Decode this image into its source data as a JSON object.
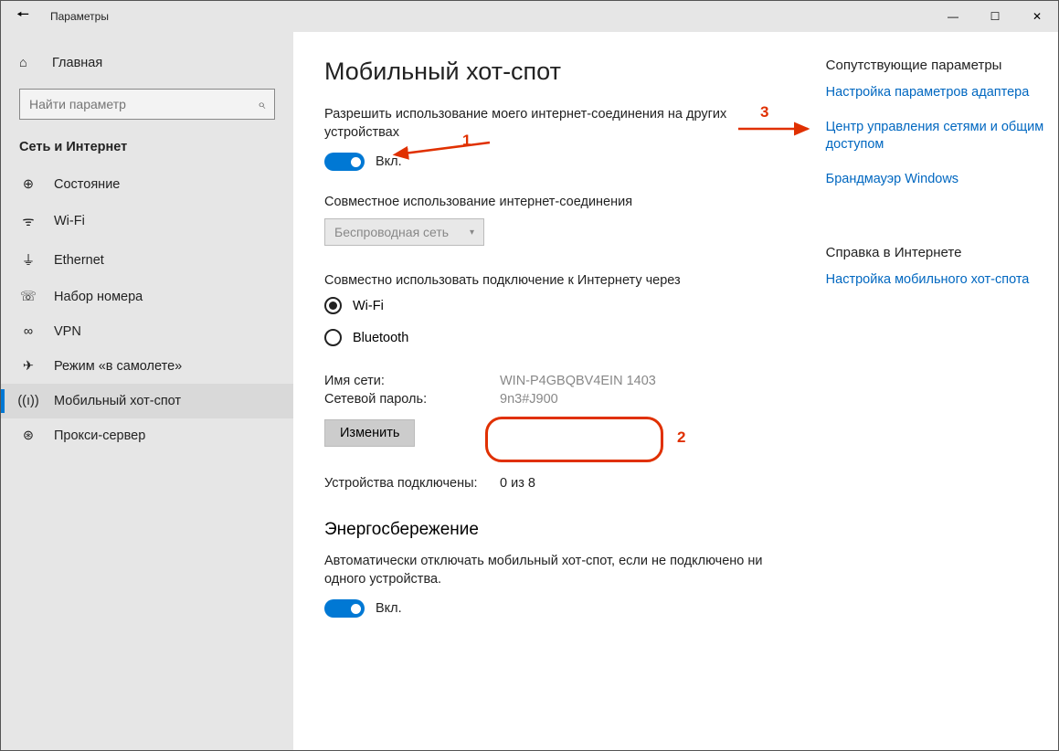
{
  "titlebar": {
    "title": "Параметры"
  },
  "sidebar": {
    "home": "Главная",
    "search_placeholder": "Найти параметр",
    "section": "Сеть и Интернет",
    "items": [
      {
        "label": "Состояние"
      },
      {
        "label": "Wi-Fi"
      },
      {
        "label": "Ethernet"
      },
      {
        "label": "Набор номера"
      },
      {
        "label": "VPN"
      },
      {
        "label": "Режим «в самолете»"
      },
      {
        "label": "Мобильный хот-спот"
      },
      {
        "label": "Прокси-сервер"
      }
    ]
  },
  "main": {
    "heading": "Мобильный хот-спот",
    "share_desc": "Разрешить использование моего интернет-соединения на других устройствах",
    "toggle_on": "Вкл.",
    "connection_label": "Совместное использование интернет-соединения",
    "connection_value": "Беспроводная сеть",
    "share_over_label": "Совместно использовать подключение к Интернету через",
    "radio_wifi": "Wi-Fi",
    "radio_bt": "Bluetooth",
    "net_name_label": "Имя сети:",
    "net_name_value": "WIN-P4GBQBV4EIN 1403",
    "net_pass_label": "Сетевой пароль:",
    "net_pass_value": "9n3#J900",
    "edit_btn": "Изменить",
    "devices_label": "Устройства подключены:",
    "devices_value": "0 из 8",
    "power_heading": "Энергосбережение",
    "power_desc": "Автоматически отключать мобильный хот-спот, если не подключено ни одного устройства.",
    "power_toggle": "Вкл."
  },
  "right": {
    "related_head": "Сопутствующие параметры",
    "link1": "Настройка параметров адаптера",
    "link2": "Центр управления сетями и общим доступом",
    "link3": "Брандмауэр Windows",
    "help_head": "Справка в Интернете",
    "help_link": "Настройка мобильного хот-спота"
  },
  "annot": {
    "n1": "1",
    "n2": "2",
    "n3": "3"
  }
}
